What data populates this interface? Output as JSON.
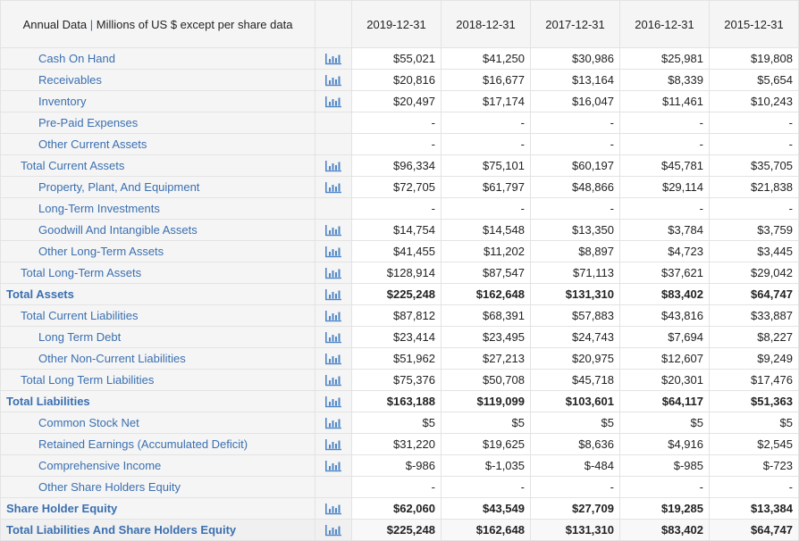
{
  "header": {
    "title_left": "Annual Data",
    "title_sep": "|",
    "title_right": "Millions of US $ except per share data",
    "dates": [
      "2019-12-31",
      "2018-12-31",
      "2017-12-31",
      "2016-12-31",
      "2015-12-31"
    ]
  },
  "rows": [
    {
      "label": "Cash On Hand",
      "level": 2,
      "chart": true,
      "values": [
        "$55,021",
        "$41,250",
        "$30,986",
        "$25,981",
        "$19,808"
      ]
    },
    {
      "label": "Receivables",
      "level": 2,
      "chart": true,
      "values": [
        "$20,816",
        "$16,677",
        "$13,164",
        "$8,339",
        "$5,654"
      ]
    },
    {
      "label": "Inventory",
      "level": 2,
      "chart": true,
      "values": [
        "$20,497",
        "$17,174",
        "$16,047",
        "$11,461",
        "$10,243"
      ]
    },
    {
      "label": "Pre-Paid Expenses",
      "level": 2,
      "chart": false,
      "values": [
        "-",
        "-",
        "-",
        "-",
        "-"
      ]
    },
    {
      "label": "Other Current Assets",
      "level": 2,
      "chart": false,
      "values": [
        "-",
        "-",
        "-",
        "-",
        "-"
      ]
    },
    {
      "label": "Total Current Assets",
      "level": 1,
      "chart": true,
      "values": [
        "$96,334",
        "$75,101",
        "$60,197",
        "$45,781",
        "$35,705"
      ]
    },
    {
      "label": "Property, Plant, And Equipment",
      "level": 2,
      "chart": true,
      "values": [
        "$72,705",
        "$61,797",
        "$48,866",
        "$29,114",
        "$21,838"
      ]
    },
    {
      "label": "Long-Term Investments",
      "level": 2,
      "chart": false,
      "values": [
        "-",
        "-",
        "-",
        "-",
        "-"
      ]
    },
    {
      "label": "Goodwill And Intangible Assets",
      "level": 2,
      "chart": true,
      "values": [
        "$14,754",
        "$14,548",
        "$13,350",
        "$3,784",
        "$3,759"
      ]
    },
    {
      "label": "Other Long-Term Assets",
      "level": 2,
      "chart": true,
      "values": [
        "$41,455",
        "$11,202",
        "$8,897",
        "$4,723",
        "$3,445"
      ]
    },
    {
      "label": "Total Long-Term Assets",
      "level": 1,
      "chart": true,
      "values": [
        "$128,914",
        "$87,547",
        "$71,113",
        "$37,621",
        "$29,042"
      ]
    },
    {
      "label": "Total Assets",
      "level": 0,
      "chart": true,
      "bold": true,
      "values": [
        "$225,248",
        "$162,648",
        "$131,310",
        "$83,402",
        "$64,747"
      ]
    },
    {
      "label": "Total Current Liabilities",
      "level": 1,
      "chart": true,
      "values": [
        "$87,812",
        "$68,391",
        "$57,883",
        "$43,816",
        "$33,887"
      ]
    },
    {
      "label": "Long Term Debt",
      "level": 2,
      "chart": true,
      "values": [
        "$23,414",
        "$23,495",
        "$24,743",
        "$7,694",
        "$8,227"
      ]
    },
    {
      "label": "Other Non-Current Liabilities",
      "level": 2,
      "chart": true,
      "values": [
        "$51,962",
        "$27,213",
        "$20,975",
        "$12,607",
        "$9,249"
      ]
    },
    {
      "label": "Total Long Term Liabilities",
      "level": 1,
      "chart": true,
      "values": [
        "$75,376",
        "$50,708",
        "$45,718",
        "$20,301",
        "$17,476"
      ]
    },
    {
      "label": "Total Liabilities",
      "level": 0,
      "chart": true,
      "bold": true,
      "values": [
        "$163,188",
        "$119,099",
        "$103,601",
        "$64,117",
        "$51,363"
      ]
    },
    {
      "label": "Common Stock Net",
      "level": 2,
      "chart": true,
      "values": [
        "$5",
        "$5",
        "$5",
        "$5",
        "$5"
      ]
    },
    {
      "label": "Retained Earnings (Accumulated Deficit)",
      "level": 2,
      "chart": true,
      "values": [
        "$31,220",
        "$19,625",
        "$8,636",
        "$4,916",
        "$2,545"
      ]
    },
    {
      "label": "Comprehensive Income",
      "level": 2,
      "chart": true,
      "values": [
        "$-986",
        "$-1,035",
        "$-484",
        "$-985",
        "$-723"
      ]
    },
    {
      "label": "Other Share Holders Equity",
      "level": 2,
      "chart": false,
      "values": [
        "-",
        "-",
        "-",
        "-",
        "-"
      ]
    },
    {
      "label": "Share Holder Equity",
      "level": 0,
      "chart": true,
      "bold": true,
      "values": [
        "$62,060",
        "$43,549",
        "$27,709",
        "$19,285",
        "$13,384"
      ]
    },
    {
      "label": "Total Liabilities And Share Holders Equity",
      "level": 0,
      "chart": true,
      "bold": true,
      "values": [
        "$225,248",
        "$162,648",
        "$131,310",
        "$83,402",
        "$64,747"
      ]
    }
  ],
  "colors": {
    "label_text": "#3a6fb0",
    "icon": "#4f86c6",
    "header_bg": "#f5f5f5"
  },
  "icon_name": "bar-chart-icon"
}
